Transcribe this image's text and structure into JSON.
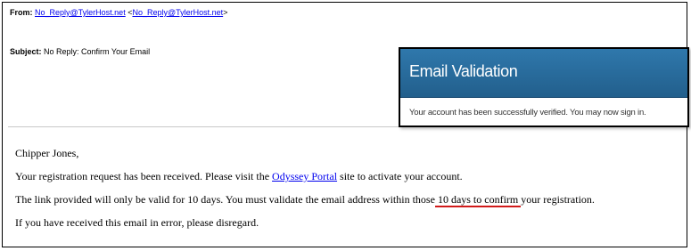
{
  "email": {
    "from_label": "From:",
    "from_address": "No_Reply@TylerHost.net",
    "from_address_bracketed": "No_Reply@TylerHost.net",
    "subject_label": "Subject:",
    "subject_text": "No Reply: Confirm Your Email",
    "greeting": "Chipper Jones,",
    "line2_before": "Your registration request has been received. Please visit the ",
    "line2_link": "Odyssey Portal",
    "line2_after": " site to activate your account.",
    "line3_before": "The link provided will only be valid for 10 days. You must validate the email address within those",
    "line3_highlight": " 10 days to confirm ",
    "line3_after": "your registration.",
    "line4": "If you have received this email in error, please disregard."
  },
  "popup": {
    "title": "Email Validation",
    "message": "Your account has been successfully verified. You may now sign in."
  },
  "colors": {
    "link": "#0000ee",
    "annotation_underline": "#d11a1a",
    "popup_header": "#2a6d9e"
  }
}
